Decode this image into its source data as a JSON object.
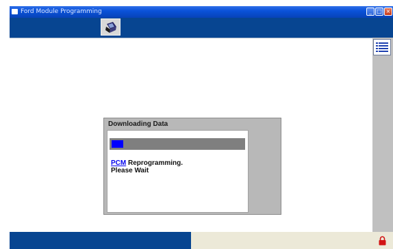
{
  "window": {
    "title": "Ford Module Programming"
  },
  "titlebar": {
    "minimize_glyph": "_",
    "maximize_glyph": "□",
    "close_glyph": "×"
  },
  "dialog": {
    "title": "Downloading Data",
    "progress_fraction": 0.09,
    "module_link": "PCM",
    "message_rest": " Reprogramming.",
    "message_line2": "Please Wait"
  },
  "icons": {
    "toolbar_tool": "disk-pointer-icon",
    "right_panel": "list-icon",
    "status": "padlock-icon"
  },
  "colors": {
    "titlebar": "#0a52d9",
    "toolbar": "#074591",
    "progress_fill": "#0000ff",
    "progress_track": "#7f7f7f",
    "lock": "#d21414"
  }
}
